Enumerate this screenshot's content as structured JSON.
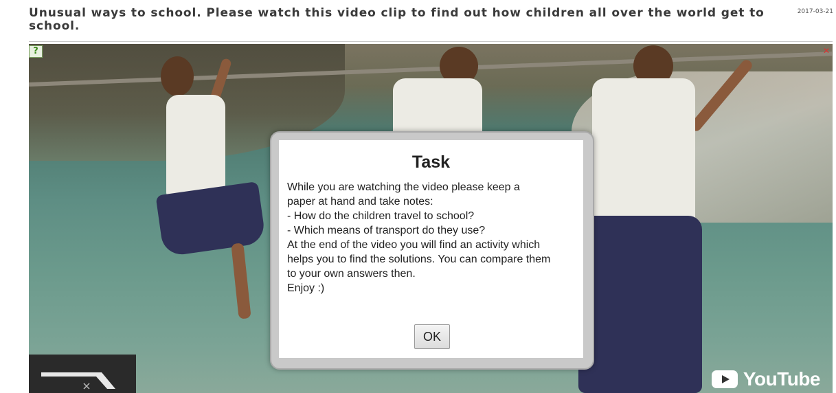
{
  "header": {
    "title": "Unusual ways to school. Please watch this video clip to find out how children all over the world get to school.",
    "date": "2017-03-21"
  },
  "player": {
    "help_icon": "?",
    "close_icon": "✕",
    "youtube_label": "YouTube"
  },
  "dialog": {
    "title": "Task",
    "lines": [
      "While you are watching the video please keep a",
      "paper at hand and take notes:",
      "- How do the children travel to school?",
      "- Which means of transport do they use?",
      "At the end of the video you will find an activity which",
      "helps you to find the solutions. You can compare them",
      "to your own answers then.",
      "Enjoy :)"
    ],
    "ok_label": "OK"
  },
  "colors": {
    "title_text": "#3a3a3a",
    "skirt": "#2f3157",
    "shirt": "#ecebe4",
    "water": "#5e8e84"
  }
}
